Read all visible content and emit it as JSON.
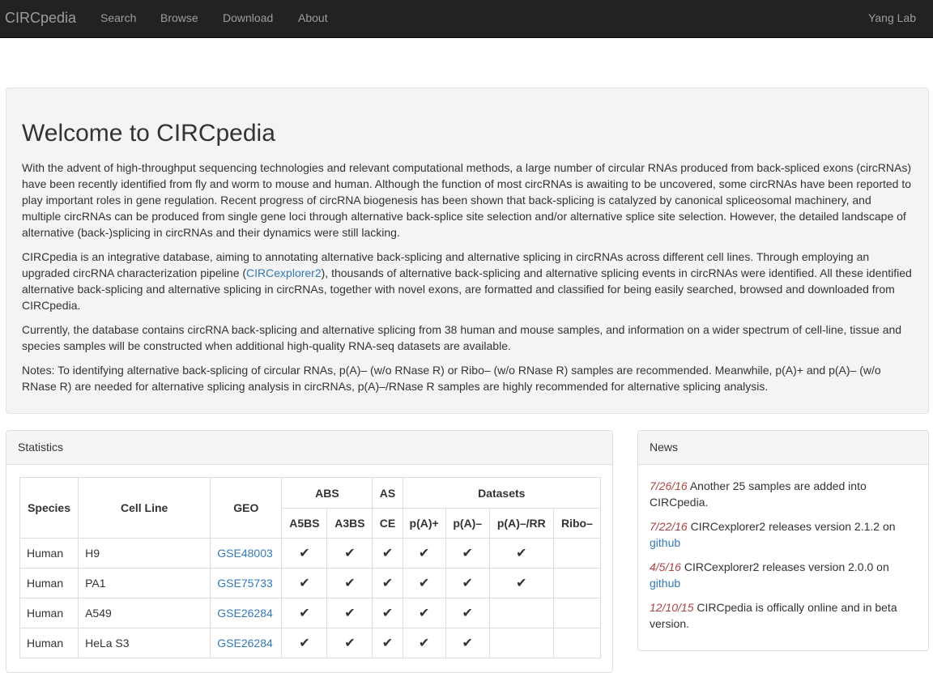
{
  "navbar": {
    "brand": "CIRCpedia",
    "links": [
      "Search",
      "Browse",
      "Download",
      "About"
    ],
    "right": "Yang Lab"
  },
  "welcome": {
    "title": "Welcome to CIRCpedia",
    "p1": "With the advent of high-throughput sequencing technologies and relevant computational methods, a large number of circular RNAs produced from back-spliced exons (circRNAs) have been recently identified from fly and worm to mouse and human. Although the function of most circRNAs is awaiting to be uncovered, some circRNAs have been reported to play important roles in gene regulation. Recent progress of circRNA biogenesis has been shown that back-splicing is catalyzed by canonical spliceosomal machinery, and multiple circRNAs can be produced from single gene loci through alternative back-splice site selection and/or alternative splice site selection. However, the detailed landscape of alternative (back-)splicing in circRNAs and their dynamics were still lacking.",
    "p2_before": "CIRCpedia is an integrative database, aiming to annotating alternative back-splicing and alternative splicing in circRNAs across different cell lines. Through employing an upgraded circRNA characterization pipeline (",
    "p2_link": "CIRCexplorer2",
    "p2_after": "), thousands of alternative back-splicing and alternative splicing events in circRNAs were identified. All these identified alternative back-splicing and alternative splicing in circRNAs, together with novel exons, are formatted and classified for being easily searched, browsed and downloaded from CIRCpedia.",
    "p3": "Currently, the database contains circRNA back-splicing and alternative splicing from 38 human and mouse samples, and information on a wider spectrum of cell-line, tissue and species samples will be constructed when additional high-quality RNA-seq datasets are available.",
    "p4": "Notes: To identifying alternative back-splicing of circular RNAs, p(A)– (w/o RNase R) or Ribo– (w/o RNase R) samples are recommended. Meanwhile, p(A)+ and p(A)– (w/o RNase R) are needed for alternative splicing analysis in circRNAs, p(A)–/RNase R samples are highly recommended for alternative splicing analysis."
  },
  "statistics": {
    "heading": "Statistics",
    "head": {
      "species": "Species",
      "cell_line": "Cell Line",
      "geo": "GEO",
      "abs": "ABS",
      "as": "AS",
      "datasets": "Datasets",
      "a5bs": "A5BS",
      "a3bs": "A3BS",
      "ce": "CE",
      "pa_plus": "p(A)+",
      "pa_minus": "p(A)–",
      "pa_rr": "p(A)–/RR",
      "ribo": "Ribo–"
    },
    "check_glyph": "✔",
    "rows": [
      {
        "species": "Human",
        "cell": "H9",
        "geo": "GSE48003",
        "checks": [
          true,
          true,
          true,
          true,
          true,
          true,
          false
        ]
      },
      {
        "species": "Human",
        "cell": "PA1",
        "geo": "GSE75733",
        "checks": [
          true,
          true,
          true,
          true,
          true,
          true,
          false
        ]
      },
      {
        "species": "Human",
        "cell": "A549",
        "geo": "GSE26284",
        "checks": [
          true,
          true,
          true,
          true,
          true,
          false,
          false
        ]
      },
      {
        "species": "Human",
        "cell": "HeLa S3",
        "geo": "GSE26284",
        "checks": [
          true,
          true,
          true,
          true,
          true,
          false,
          false
        ]
      }
    ]
  },
  "news": {
    "heading": "News",
    "items": [
      {
        "date": "7/26/16",
        "text": " Another 25 samples are added into CIRCpedia.",
        "link": ""
      },
      {
        "date": "7/22/16",
        "text": " CIRCexplorer2 releases version 2.1.2 on ",
        "link": "github"
      },
      {
        "date": "4/5/16",
        "text": " CIRCexplorer2 releases version 2.0.0 on ",
        "link": "github"
      },
      {
        "date": "12/10/15",
        "text": " CIRCpedia is offically online and in beta version.",
        "link": ""
      }
    ]
  }
}
